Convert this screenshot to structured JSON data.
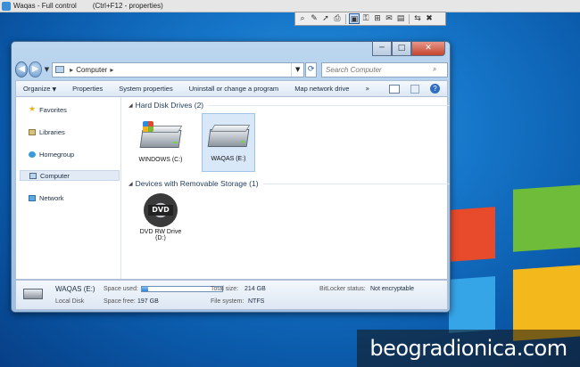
{
  "remote_bar": {
    "title": "Waqas - Full control",
    "shortcut": "(Ctrl+F12 - properties)"
  },
  "remote_toolbar": {
    "icons": [
      "zoom-icon",
      "pen-icon",
      "pointer-icon",
      "print-icon",
      "screen-icon",
      "lock-icon",
      "network-icon",
      "chat-icon",
      "folder-icon",
      "transfer-icon",
      "disconnect-icon"
    ]
  },
  "window": {
    "min": "─",
    "max": "□",
    "close": "✕"
  },
  "address_bar": {
    "path": [
      "Computer"
    ],
    "separator": "▸",
    "search_placeholder": "Search Computer"
  },
  "toolbar": {
    "organize": "Organize",
    "properties": "Properties",
    "system_properties": "System properties",
    "uninstall": "Uninstall or change a program",
    "map_drive": "Map network drive",
    "more": "»",
    "help": "?"
  },
  "sidebar": {
    "items": [
      {
        "label": "Favorites"
      },
      {
        "label": "Libraries"
      },
      {
        "label": "Homegroup"
      },
      {
        "label": "Computer"
      },
      {
        "label": "Network"
      }
    ]
  },
  "groups": {
    "hard_disks": {
      "title": "Hard Disk Drives (2)",
      "drives": [
        {
          "label": "WINDOWS (C:)"
        },
        {
          "label": "WAQAS (E:)"
        }
      ]
    },
    "removable": {
      "title": "Devices with Removable Storage (1)",
      "devices": [
        {
          "label_line1": "DVD RW Drive",
          "label_line2": "(D:)",
          "disc_text": "DVD"
        }
      ]
    }
  },
  "details": {
    "name": "WAQAS (E:)",
    "type": "Local Disk",
    "space_used_label": "Space used:",
    "space_used_fraction": 0.08,
    "space_free_label": "Space free:",
    "space_free": "197 GB",
    "total_size_label": "Total size:",
    "total_size": "214 GB",
    "file_system_label": "File system:",
    "file_system": "NTFS",
    "bitlocker_label": "BitLocker status:",
    "bitlocker": "Not encryptable"
  },
  "watermark": "beogradionica.com",
  "colors": {
    "accent": "#2c83d2",
    "wallpaper": "#1676c9"
  }
}
